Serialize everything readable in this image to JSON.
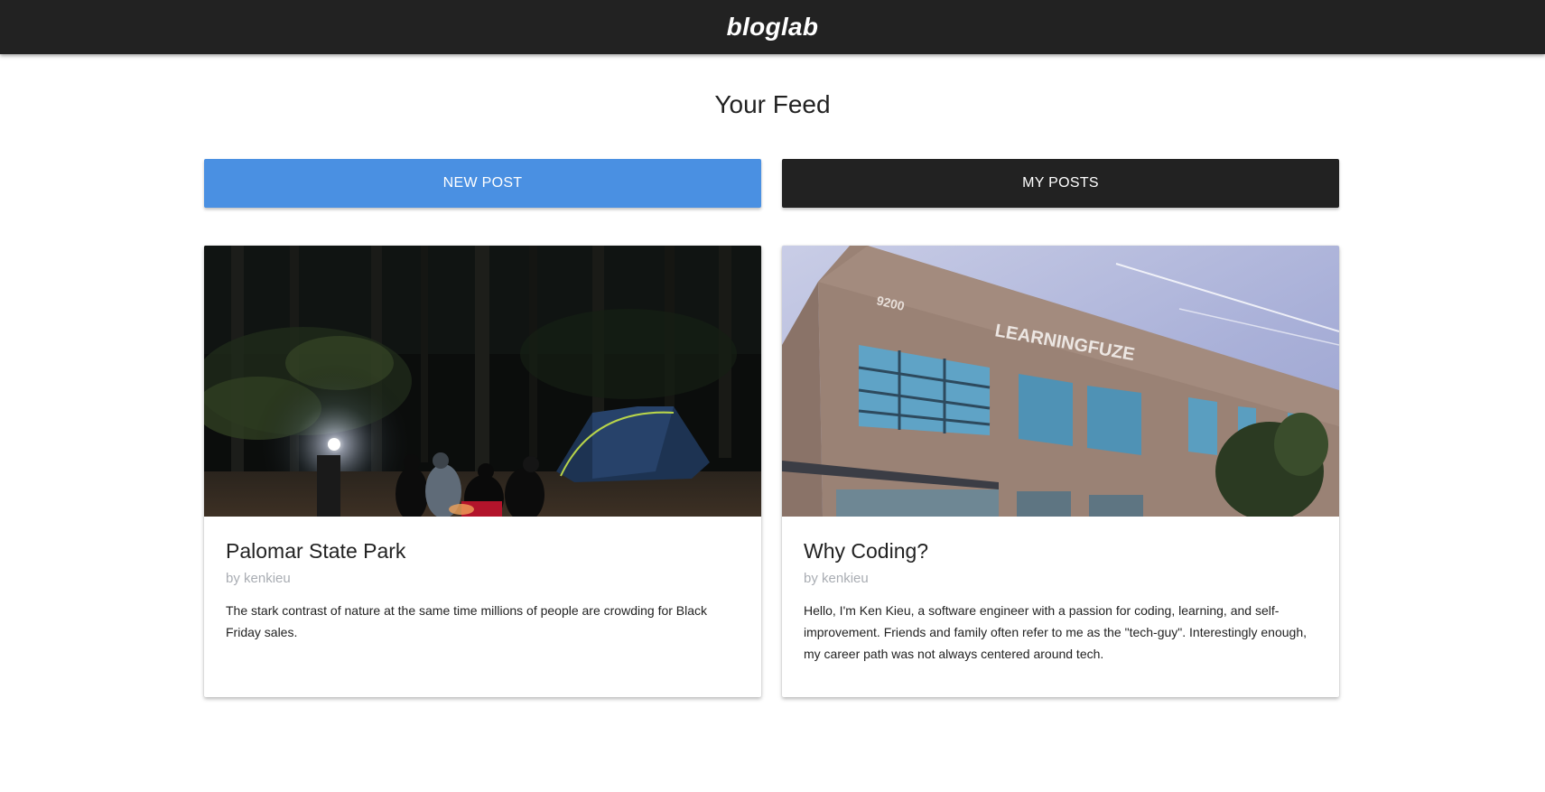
{
  "header": {
    "brand": "bloglab"
  },
  "main": {
    "title": "Your Feed",
    "new_post_label": "NEW POST",
    "my_posts_label": "MY POSTS"
  },
  "posts": [
    {
      "title": "Palomar State Park",
      "author": "by kenkieu",
      "body": "The stark contrast of nature at the same time millions of people are crowding for Black Friday sales.",
      "image_alt": "night campsite with tent and campfire"
    },
    {
      "title": "Why Coding?",
      "author": "by kenkieu",
      "body": "Hello, I'm Ken Kieu, a software engineer with a passion for coding, learning, and self-improvement. Friends and family often refer to me as the \"tech-guy\". Interestingly enough, my career path was not always centered around tech.",
      "image_alt": "LearningFuze building exterior",
      "image_sign_number": "9200",
      "image_sign_text": "LEARNINGFUZE"
    }
  ],
  "colors": {
    "header_bg": "#222222",
    "primary_button": "#4a90e2",
    "dark_button": "#222222",
    "author_text": "#a9adb3"
  }
}
